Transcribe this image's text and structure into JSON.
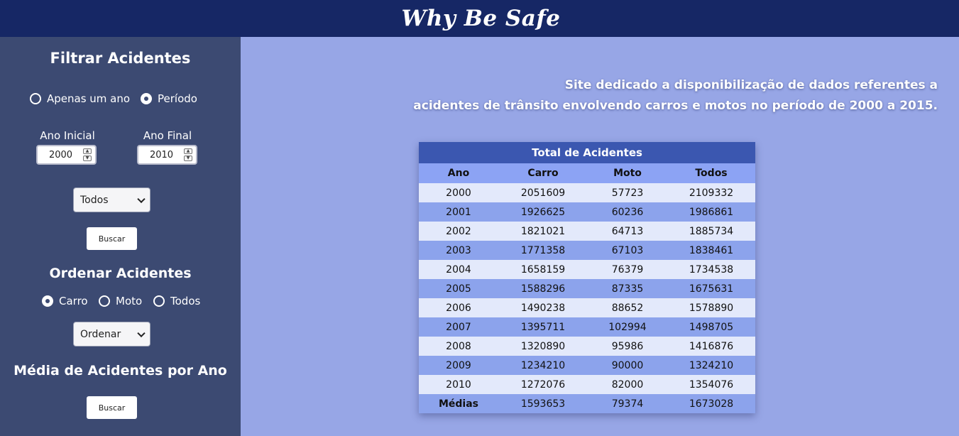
{
  "header": {
    "brand": "Why Be Safe"
  },
  "sidebar": {
    "filter_title": "Filtrar Acidentes",
    "mode_options": [
      {
        "label": "Apenas um ano",
        "checked": false
      },
      {
        "label": "Período",
        "checked": true
      }
    ],
    "start_year_label": "Ano Inicial",
    "start_year_value": "2000",
    "end_year_label": "Ano Final",
    "end_year_value": "2010",
    "vehicle_select": "Todos",
    "search_button": "Buscar",
    "sort_title": "Ordenar Acidentes",
    "sort_options": [
      {
        "label": "Carro",
        "checked": true
      },
      {
        "label": "Moto",
        "checked": false
      },
      {
        "label": "Todos",
        "checked": false
      }
    ],
    "sort_select": "Ordenar",
    "average_title": "Média de Acidentes por Ano",
    "average_button": "Buscar"
  },
  "main": {
    "tagline_line1": "Site dedicado a disponibilização de dados referentes a",
    "tagline_line2": "acidentes de trânsito envolvendo carros e motos no período de 2000 a 2015.",
    "table": {
      "title": "Total de Acidentes",
      "headers": [
        "Ano",
        "Carro",
        "Moto",
        "Todos"
      ],
      "rows": [
        [
          "2000",
          "2051609",
          "57723",
          "2109332"
        ],
        [
          "2001",
          "1926625",
          "60236",
          "1986861"
        ],
        [
          "2002",
          "1821021",
          "64713",
          "1885734"
        ],
        [
          "2003",
          "1771358",
          "67103",
          "1838461"
        ],
        [
          "2004",
          "1658159",
          "76379",
          "1734538"
        ],
        [
          "2005",
          "1588296",
          "87335",
          "1675631"
        ],
        [
          "2006",
          "1490238",
          "88652",
          "1578890"
        ],
        [
          "2007",
          "1395711",
          "102994",
          "1498705"
        ],
        [
          "2008",
          "1320890",
          "95986",
          "1416876"
        ],
        [
          "2009",
          "1234210",
          "90000",
          "1324210"
        ],
        [
          "2010",
          "1272076",
          "82000",
          "1354076"
        ]
      ],
      "footer": [
        "Médias",
        "1593653",
        "79374",
        "1673028"
      ]
    }
  },
  "colors": {
    "header_bg": "#162765",
    "sidebar_bg": "#3c4a72",
    "page_bg": "#97a6e6",
    "table_title_bg": "#3b57b0",
    "table_head_bg": "#8ca3f4"
  }
}
